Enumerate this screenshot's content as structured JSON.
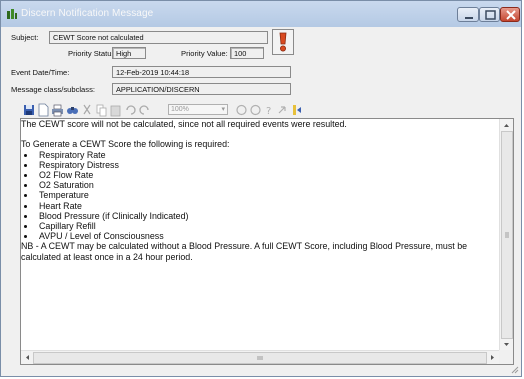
{
  "window": {
    "title": "Discern Notification Message"
  },
  "header": {
    "subject_label": "Subject:",
    "subject_value": "CEWT Score not calculated",
    "priority_status_label": "Priority Status:",
    "priority_status_value": "High",
    "priority_value_label": "Priority Value:",
    "priority_value_value": "100",
    "event_datetime_label": "Event Date/Time:",
    "event_datetime_value": "12-Feb-2019 10:44:18",
    "message_class_label": "Message class/subclass:",
    "message_class_value": "APPLICATION/DISCERN"
  },
  "toolbar": {
    "zoom_value": "100%",
    "icons": [
      "save-icon",
      "new-icon",
      "print-icon",
      "find-icon",
      "cut-icon",
      "copy-icon",
      "paste-icon",
      "undo-icon",
      "redo-icon",
      "zoom-combo",
      "nav-back-icon",
      "nav-forward-icon",
      "help-icon",
      "refresh-icon",
      "insert-icon"
    ]
  },
  "document": {
    "intro": "The CEWT score will not be calculated, since not all required events were resulted.",
    "lead": "To Generate a CEWT Score the following is required:",
    "requirements": [
      "Respiratory Rate",
      "Respiratory Distress",
      "O2 Flow Rate",
      "O2 Saturation",
      "Temperature",
      "Heart Rate",
      "Blood Pressure (if Clinically Indicated)",
      "Capillary Refill",
      "AVPU / Level of Consciousness"
    ],
    "note": "NB - A CEWT may be calculated without a Blood Pressure. A full CEWT Score, including Blood Pressure, must be calculated at least once in a 24 hour period."
  },
  "colors": {
    "titlebar": "#b4c9e4",
    "close_button": "#c4452f",
    "alert_icon": "#d94a21"
  }
}
